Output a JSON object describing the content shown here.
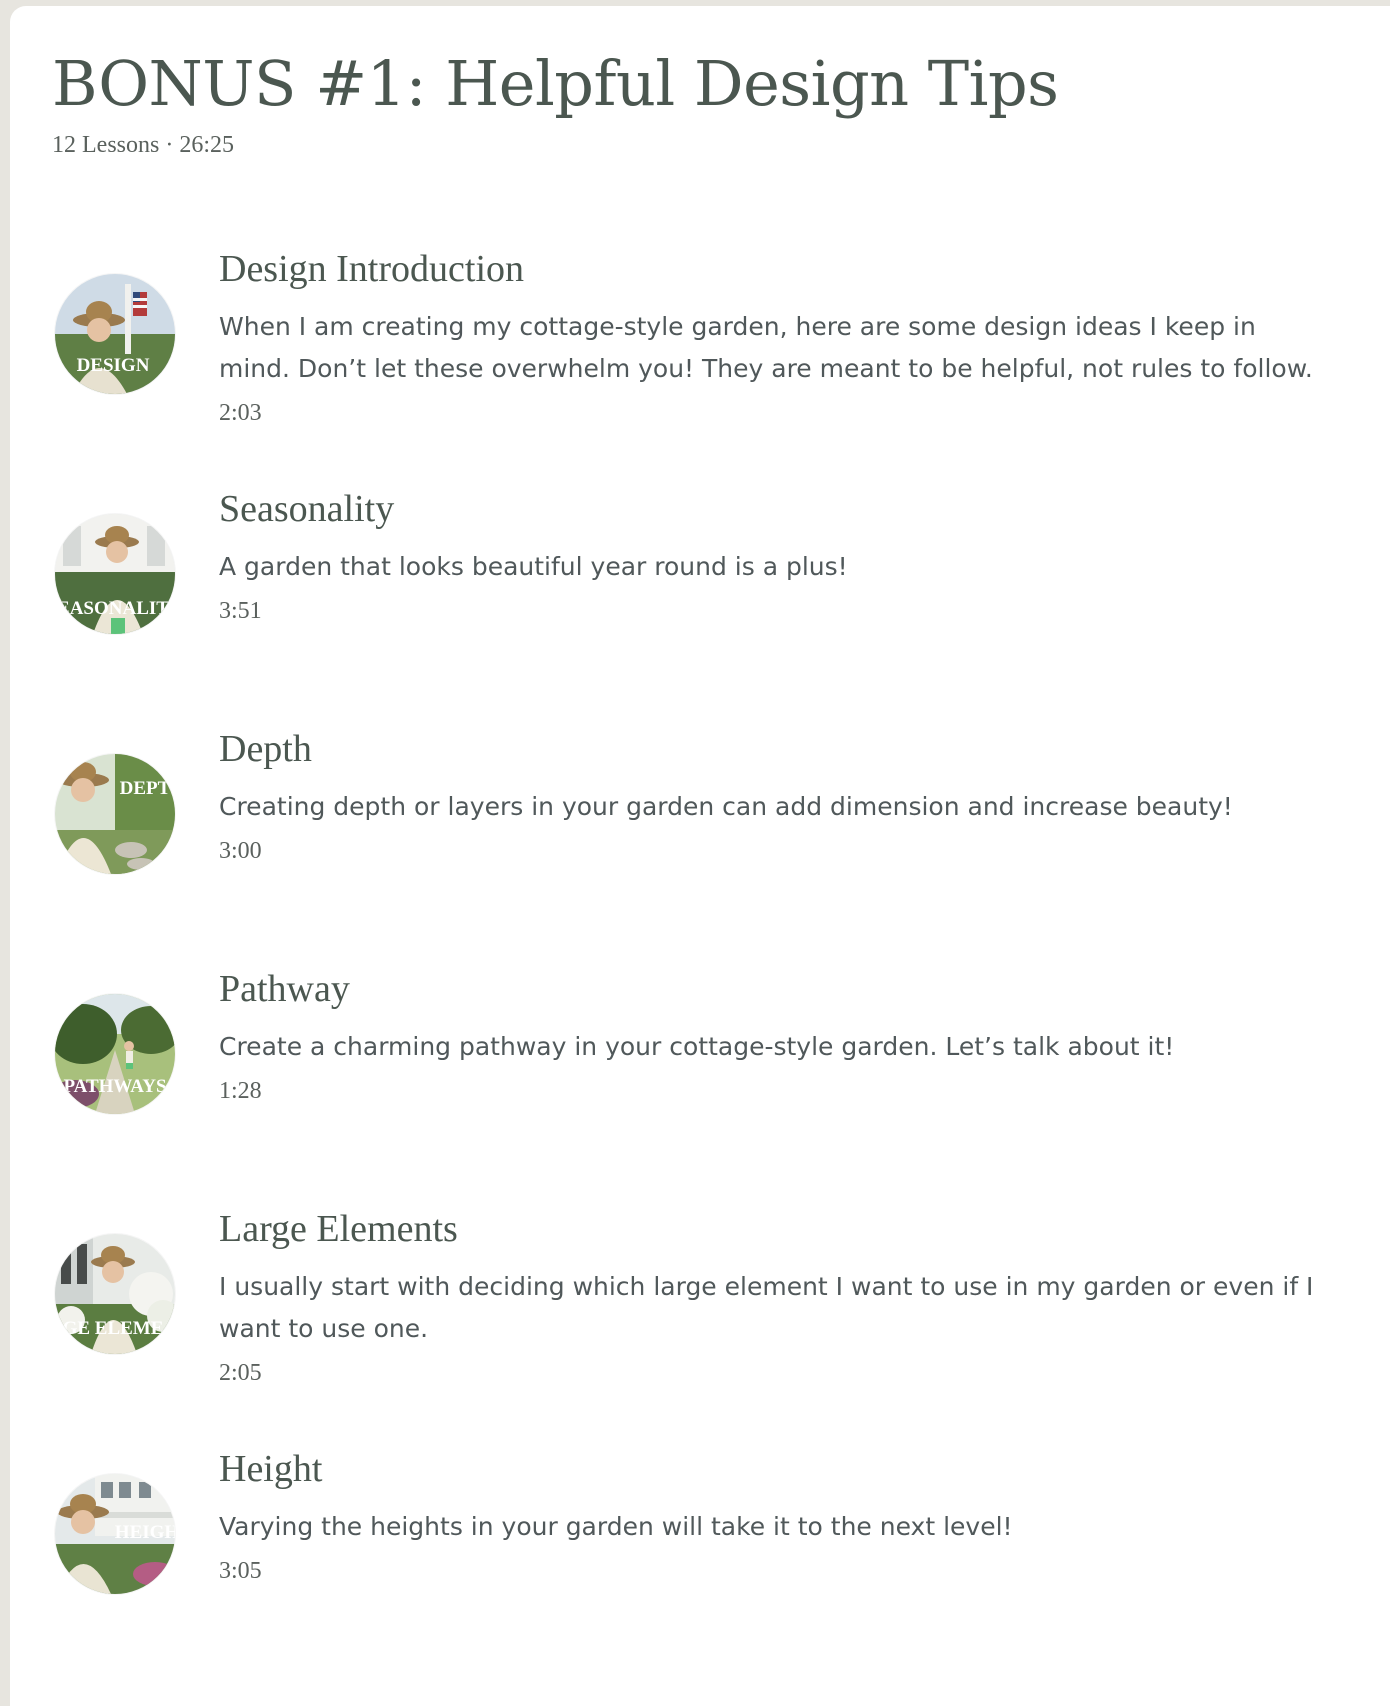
{
  "course": {
    "title": "BONUS #1: Helpful Design Tips",
    "meta": "12 Lessons · 26:25"
  },
  "lessons": [
    {
      "title": "Design Introduction",
      "description": "When I am creating my cottage-style garden, here are some design ideas I keep in mind. Don’t let these overwhelm you! They are meant to be helpful, not rules to follow.",
      "duration": "2:03",
      "thumb_label": "DESIGN"
    },
    {
      "title": "Seasonality",
      "description": "A garden that looks beautiful year round is a plus!",
      "duration": "3:51",
      "thumb_label": "EASONALIT"
    },
    {
      "title": "Depth",
      "description": "Creating depth or layers in your garden can add dimension and increase beauty!",
      "duration": "3:00",
      "thumb_label": "DEPT"
    },
    {
      "title": "Pathway",
      "description": "Create a charming pathway in your cottage-style garden. Let’s talk about it!",
      "duration": "1:28",
      "thumb_label": "PATHWAYS"
    },
    {
      "title": "Large Elements",
      "description": "I usually start with deciding which large element I want to use in my garden or even if I want to use one.",
      "duration": "2:05",
      "thumb_label": "GE ELEME"
    },
    {
      "title": "Height",
      "description": "Varying the heights in your garden will take it to the next level!",
      "duration": "3:05",
      "thumb_label": "HEIGH"
    }
  ]
}
